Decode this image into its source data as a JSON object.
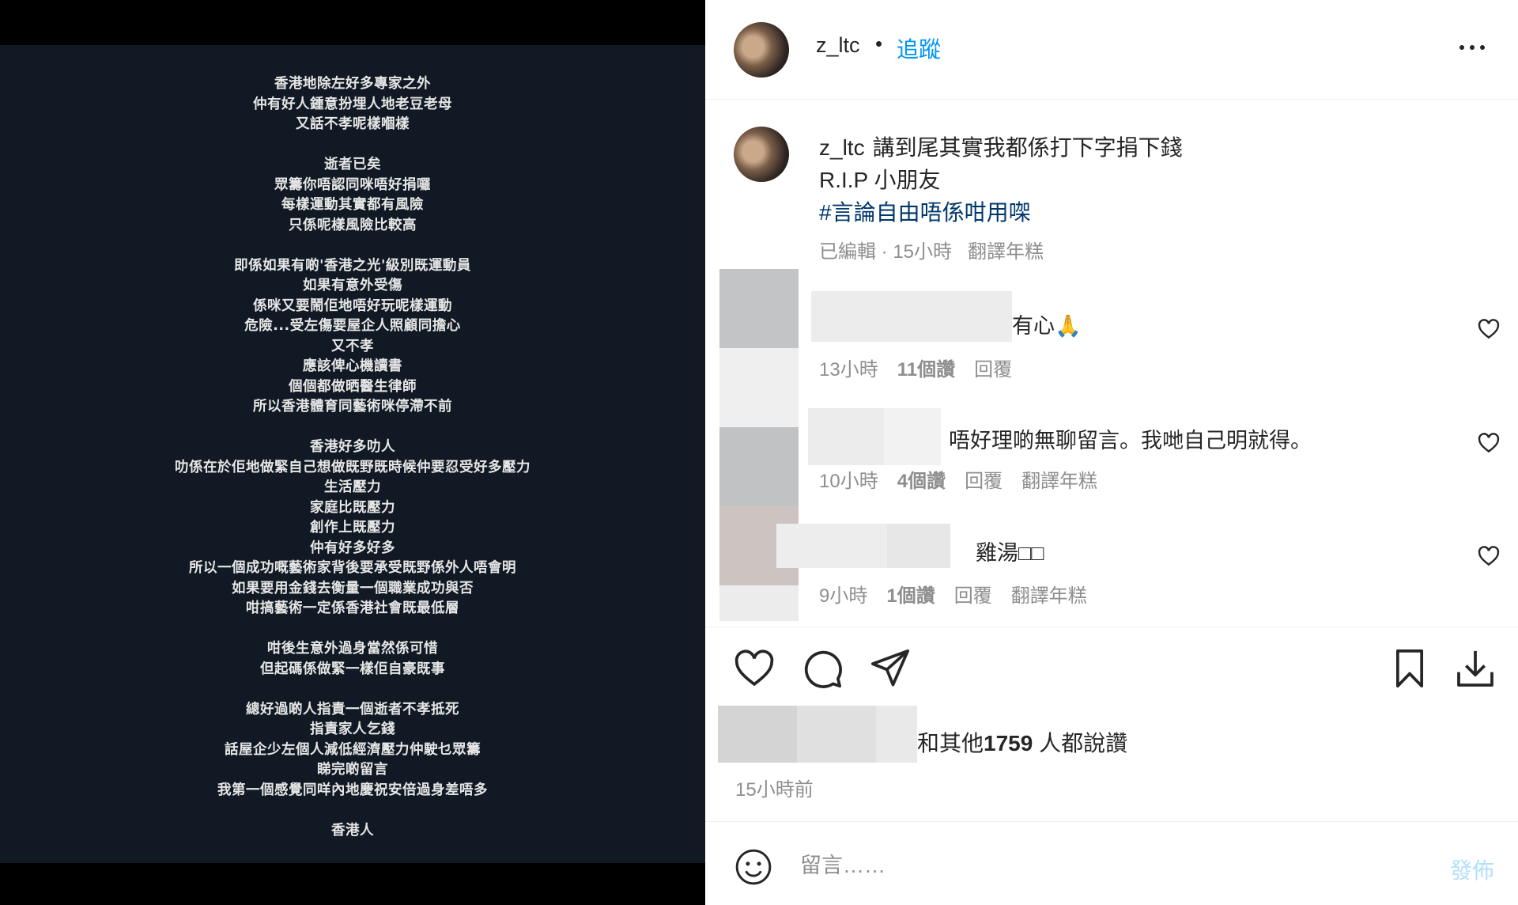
{
  "media": {
    "poem_lines": [
      "香港地除左好多專家之外",
      "仲有好人鍾意扮埋人地老豆老母",
      "又話不孝呢樣嗰樣",
      "",
      "逝者已矣",
      "眾籌你唔認同咪唔好捐囉",
      "每樣運動其實都有風險",
      "只係呢樣風險比較高",
      "",
      "即係如果有啲'香港之光'級別既運動員",
      "如果有意外受傷",
      "係咪又要鬧佢地唔好玩呢樣運動",
      "危險...受左傷要屋企人照顧同擔心",
      "又不孝",
      "應該俾心機讀書",
      "個個都做晒醫生律師",
      "所以香港體育同藝術咪停滯不前",
      "",
      "香港好多叻人",
      "叻係在於佢地做緊自己想做既野既時候仲要忍受好多壓力",
      "生活壓力",
      "家庭比既壓力",
      "創作上既壓力",
      "仲有好多好多",
      "所以一個成功嘅藝術家背後要承受既野係外人唔會明",
      "如果要用金錢去衡量一個職業成功與否",
      "咁搞藝術一定係香港社會既最低層",
      "",
      "咁後生意外過身當然係可惜",
      "但起碼係做緊一樣佢自豪既事",
      "",
      "總好過啲人指責一個逝者不孝抵死",
      "指責家人乞錢",
      "話屋企少左個人減低經濟壓力仲駛乜眾籌",
      "睇完啲留言",
      "我第一個感覺同咩內地慶祝安倍過身差唔多",
      "",
      "香港人"
    ]
  },
  "header": {
    "username": "z_ltc",
    "separator": "•",
    "follow_label": "追蹤"
  },
  "caption": {
    "username": "z_ltc",
    "line1": "講到尾其實我都係打下字捐下錢",
    "line2": "R.I.P 小朋友",
    "hashtag": "#言論自由唔係咁用㗎",
    "edited": "已編輯 · 15小時",
    "translate": "翻譯年糕"
  },
  "comments": [
    {
      "text": "有心🙏",
      "time": "13小時",
      "likes": "11個讚",
      "reply": "回覆",
      "translate": ""
    },
    {
      "text": "唔好理啲無聊留言。我哋自己明就得。",
      "time": "10小時",
      "likes": "4個讚",
      "reply": "回覆",
      "translate": "翻譯年糕"
    },
    {
      "text": "雞湯□□",
      "time": "9小時",
      "likes": "1個讚",
      "reply": "回覆",
      "translate": "翻譯年糕"
    }
  ],
  "likes": {
    "prefix": "和其他",
    "count": "1759",
    "suffix": " 人都說讚"
  },
  "post_time": "15小時前",
  "comment_bar": {
    "placeholder": "留言……",
    "post_label": "發佈"
  },
  "icons": {
    "more": "more-horizontal-icon",
    "like": "heart-icon",
    "comment": "comment-icon",
    "share": "send-icon",
    "save": "bookmark-icon",
    "download": "download-icon",
    "emoji": "emoji-icon"
  },
  "colors": {
    "link_blue": "#0095f6",
    "hashtag": "#00376b",
    "secondary_text": "#8e8e8e",
    "media_bg": "#111a24"
  }
}
